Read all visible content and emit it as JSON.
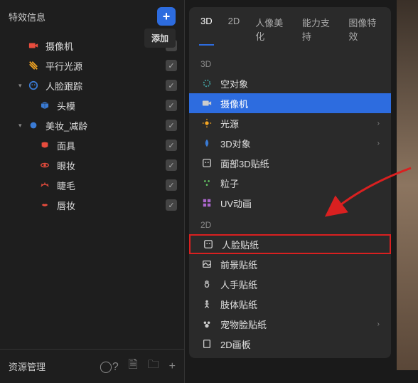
{
  "header": {
    "title": "特效信息",
    "add_tooltip": "添加"
  },
  "tree": [
    {
      "icon": "camera",
      "color": "#e84c3d",
      "label": "摄像机",
      "indent": 1,
      "chevron": ""
    },
    {
      "icon": "light",
      "color": "#f5a623",
      "label": "平行光源",
      "indent": 1,
      "chevron": ""
    },
    {
      "icon": "face",
      "color": "#3a7bd5",
      "label": "人脸跟踪",
      "indent": 1,
      "chevron": "▾"
    },
    {
      "icon": "cube",
      "color": "#3a7bd5",
      "label": "头模",
      "indent": 2,
      "chevron": ""
    },
    {
      "icon": "makeup",
      "color": "#3a7bd5",
      "label": "美妆_减龄",
      "indent": 1,
      "chevron": "▾"
    },
    {
      "icon": "mask",
      "color": "#e84c3d",
      "label": "面具",
      "indent": 2,
      "chevron": ""
    },
    {
      "icon": "eye",
      "color": "#e84c3d",
      "label": "眼妆",
      "indent": 2,
      "chevron": ""
    },
    {
      "icon": "lash",
      "color": "#e84c3d",
      "label": "睫毛",
      "indent": 2,
      "chevron": ""
    },
    {
      "icon": "lips",
      "color": "#e84c3d",
      "label": "唇妆",
      "indent": 2,
      "chevron": ""
    }
  ],
  "footer": {
    "label": "资源管理"
  },
  "tabs": [
    {
      "label": "3D",
      "active": true
    },
    {
      "label": "2D",
      "active": false
    },
    {
      "label": "人像美化",
      "active": false
    },
    {
      "label": "能力支持",
      "active": false
    },
    {
      "label": "图像特效",
      "active": false
    }
  ],
  "sections": [
    {
      "header": "3D",
      "items": [
        {
          "icon": "empty",
          "label": "空对象",
          "arrow": false
        },
        {
          "icon": "camera",
          "label": "摄像机",
          "selected": true,
          "arrow": false
        },
        {
          "icon": "sun",
          "label": "光源",
          "arrow": true
        },
        {
          "icon": "drop",
          "label": "3D对象",
          "arrow": true
        },
        {
          "icon": "facesticker",
          "label": "面部3D贴纸",
          "arrow": false
        },
        {
          "icon": "particle",
          "label": "粒子",
          "arrow": false
        },
        {
          "icon": "grid",
          "label": "UV动画",
          "arrow": false
        }
      ]
    },
    {
      "header": "2D",
      "items": [
        {
          "icon": "facesticker",
          "label": "人脸贴纸",
          "highlight": true,
          "arrow": false
        },
        {
          "icon": "image",
          "label": "前景贴纸",
          "arrow": false
        },
        {
          "icon": "hand",
          "label": "人手贴纸",
          "arrow": false
        },
        {
          "icon": "body",
          "label": "肢体贴纸",
          "arrow": false
        },
        {
          "icon": "pet",
          "label": "宠物脸贴纸",
          "arrow": true
        },
        {
          "icon": "canvas",
          "label": "2D画板",
          "arrow": false
        }
      ]
    }
  ]
}
